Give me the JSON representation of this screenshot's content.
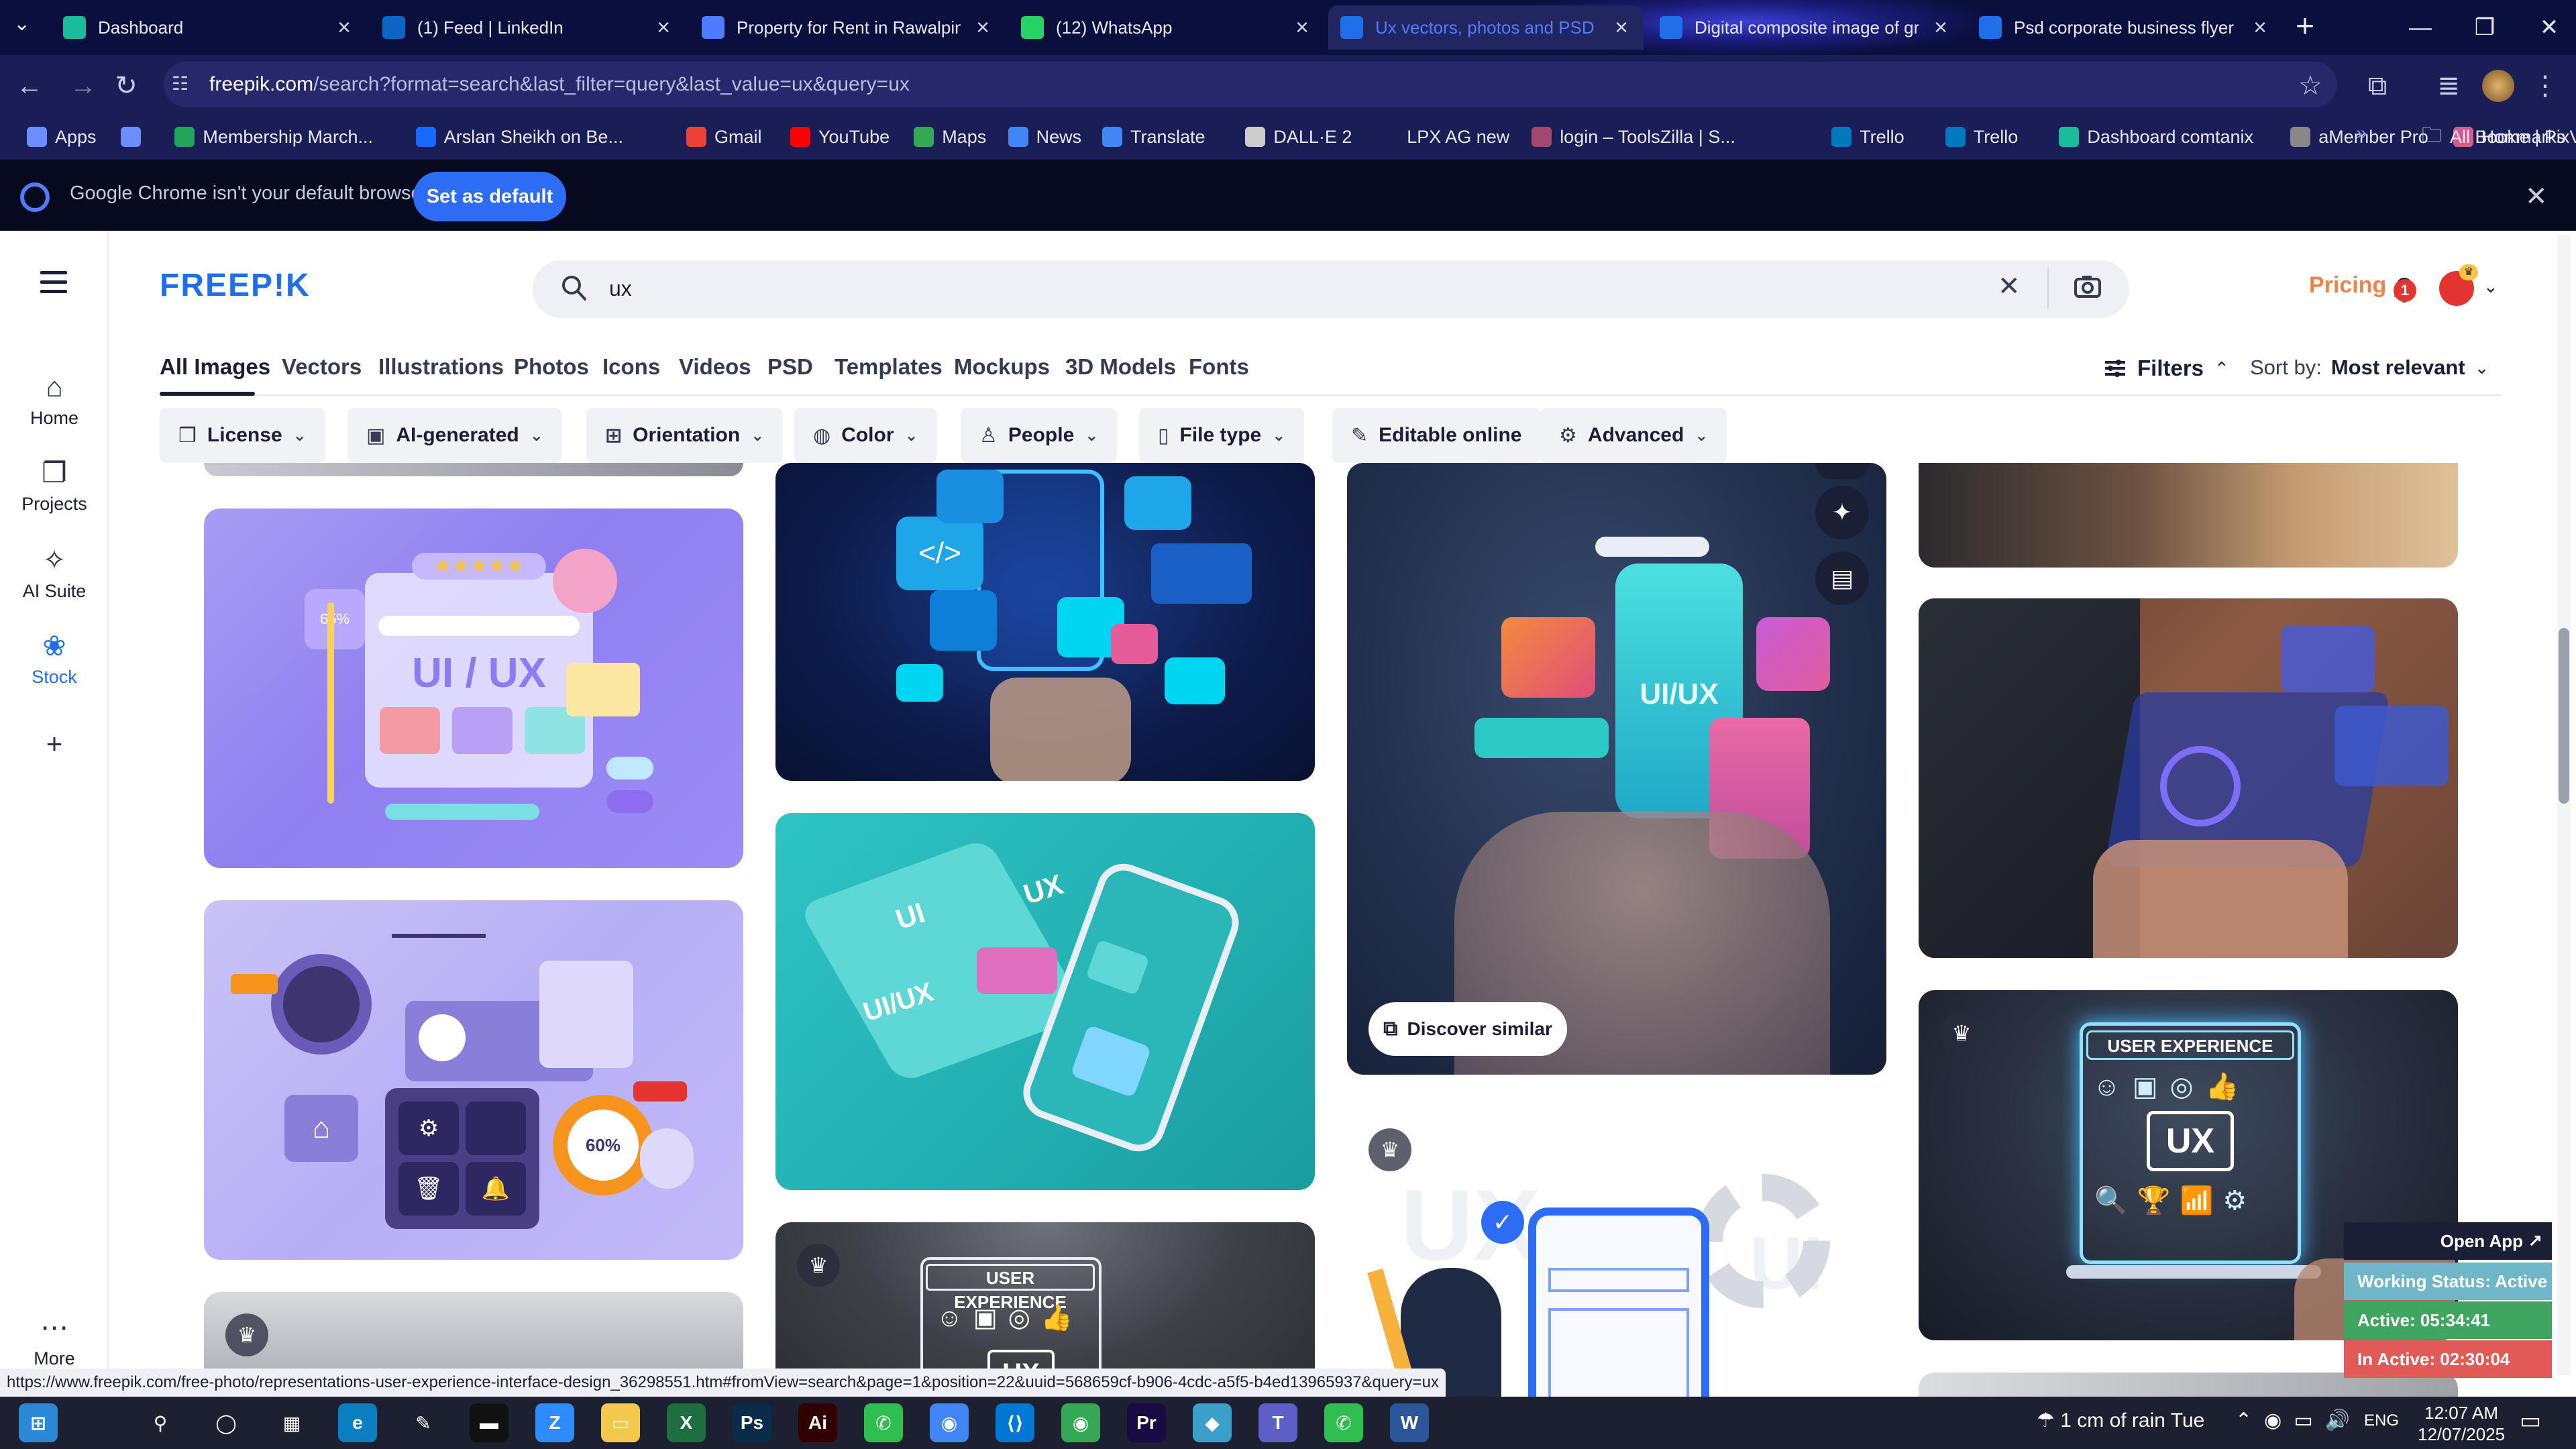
{
  "browser": {
    "tabs": [
      {
        "title": "Dashboard",
        "active": false,
        "color": "#1abc9c"
      },
      {
        "title": "(1) Feed | LinkedIn",
        "active": false,
        "color": "#0a66c2"
      },
      {
        "title": "Property for Rent in Rawalpindi",
        "active": false,
        "color": "#4f7cff"
      },
      {
        "title": "(12) WhatsApp",
        "active": false,
        "color": "#25d366"
      },
      {
        "title": "Ux vectors, photos and PSD files",
        "active": true,
        "color": "#1f6feb"
      },
      {
        "title": "Digital composite image of gra",
        "active": false,
        "color": "#1f6feb"
      },
      {
        "title": "Psd corporate business flyer de",
        "active": false,
        "color": "#1f6feb"
      }
    ],
    "url": {
      "host": "freepik.com",
      "path": "/search?format=search&last_filter=query&last_value=ux&query=ux"
    },
    "bookmarks": [
      {
        "label": "Apps",
        "color": "#6c8cff"
      },
      {
        "label": "",
        "color": "#6c8cff"
      },
      {
        "label": "Membership March...",
        "color": "#22a55b"
      },
      {
        "label": "Arslan Sheikh on Be...",
        "color": "#1769ff"
      },
      {
        "label": "Gmail",
        "color": "#ea4335"
      },
      {
        "label": "YouTube",
        "color": "#ff0000"
      },
      {
        "label": "Maps",
        "color": "#34a853"
      },
      {
        "label": "News",
        "color": "#4285f4"
      },
      {
        "label": "Translate",
        "color": "#4285f4"
      },
      {
        "label": "DALL·E 2",
        "color": "#cccccc"
      },
      {
        "label": "LPX AG new",
        "color": "#1b1d57"
      },
      {
        "label": "login – ToolsZilla | S...",
        "color": "#a0486d"
      },
      {
        "label": "Trello",
        "color": "#0079bf"
      },
      {
        "label": "Trello",
        "color": "#0079bf"
      },
      {
        "label": "Dashboard comtanix",
        "color": "#1abc9c"
      },
      {
        "label": "aMember Pro",
        "color": "#888888"
      },
      {
        "label": "Home | PixVerse",
        "color": "#d65a8a"
      }
    ],
    "all_bookmarks": "All Bookmarks",
    "infobar": {
      "message": "Google Chrome isn't your default browser",
      "button": "Set as default"
    }
  },
  "site": {
    "logo": "FREEP!K",
    "search_value": "ux",
    "pricing": "Pricing",
    "notifications": "1",
    "rail": [
      {
        "label": "Home",
        "icon": "home-icon",
        "active": false
      },
      {
        "label": "Projects",
        "icon": "projects-icon",
        "active": false
      },
      {
        "label": "AI Suite",
        "icon": "ai-suite-icon",
        "active": false
      },
      {
        "label": "Stock",
        "icon": "stock-icon",
        "active": true
      },
      {
        "label": "",
        "icon": "plus-icon",
        "active": false
      },
      {
        "label": "More",
        "icon": "more-icon",
        "active": false
      }
    ],
    "nav_tabs": [
      "All Images",
      "Vectors",
      "Illustrations",
      "Photos",
      "Icons",
      "Videos",
      "PSD",
      "Templates",
      "Mockups",
      "3D Models",
      "Fonts"
    ],
    "filters_label": "Filters",
    "sort_label": "Sort by:",
    "sort_value": "Most relevant",
    "filter_chips": [
      {
        "label": "License",
        "icon": "license-icon"
      },
      {
        "label": "AI-generated",
        "icon": "ai-generated-icon"
      },
      {
        "label": "Orientation",
        "icon": "orientation-icon"
      },
      {
        "label": "Color",
        "icon": "color-icon"
      },
      {
        "label": "People",
        "icon": "people-icon"
      },
      {
        "label": "File type",
        "icon": "file-type-icon"
      },
      {
        "label": "Editable online",
        "icon": "editable-icon"
      },
      {
        "label": "Advanced",
        "icon": "advanced-icon"
      }
    ],
    "cards": {
      "uiux_panel_text": "UI / UX",
      "uiux_percent": "65%",
      "iso_ui": "UI",
      "iso_ux": "UX",
      "iso_uiux": "UI/UX",
      "phone_uiux": "UI/UX",
      "ux_board_title": "USER EXPERIENCE",
      "ux_board_center": "UX",
      "ux_photo_title": "USER EXPERIENCE",
      "ux_photo_center": "UX",
      "dashboard_percent": "60%",
      "ux_illustration_text": "UX",
      "ux_illustration_ui": "UI"
    },
    "discover_similar": "Discover similar",
    "status_url": "https://www.freepik.com/free-photo/representations-user-experience-interface-design_36298551.htm#fromView=search&page=1&position=22&uuid=568659cf-b906-4cdc-a5f5-b4ed13965937&query=ux"
  },
  "widget": {
    "open_app": "Open App ↗",
    "working": "Working Status: Active",
    "active": "Active: 05:34:41",
    "inactive": "In Active: 02:30:04"
  },
  "taskbar": {
    "weather": "1 cm of rain Tue",
    "lang": "ENG",
    "time": "12:07 AM",
    "date": "12/07/2025"
  }
}
